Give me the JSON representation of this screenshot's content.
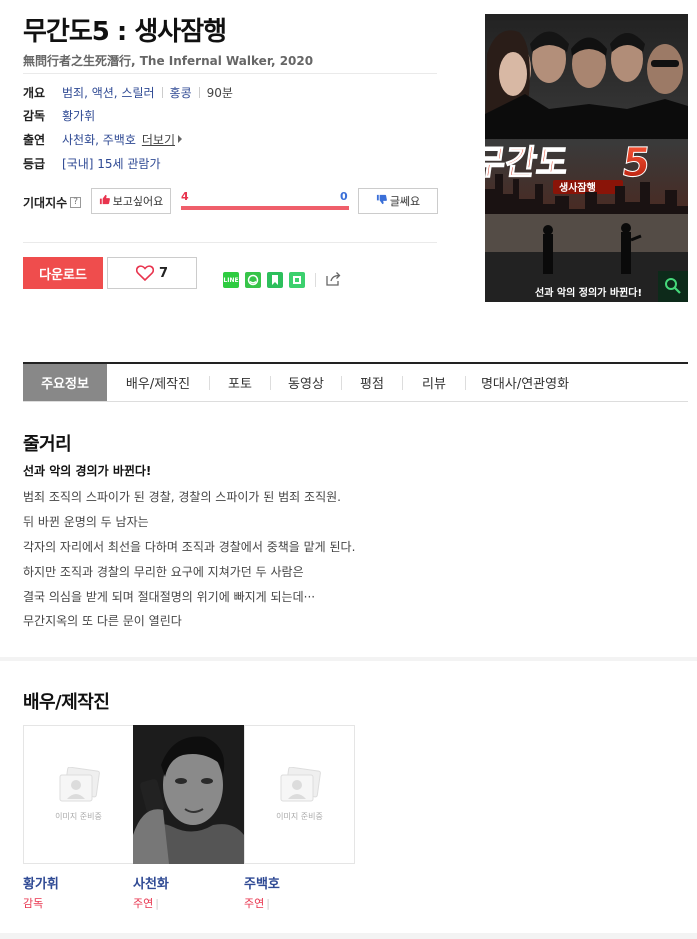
{
  "movie": {
    "title": "무간도5 : 생사잠행",
    "subtitle": "無問行者之生死潛行, The Infernal Walker, 2020"
  },
  "info": {
    "overview_label": "개요",
    "genres": "범죄, 액션, 스릴러",
    "country": "홍콩",
    "runtime": "90분",
    "director_label": "감독",
    "director": "황가휘",
    "cast_label": "출연",
    "cast": "사천화, 주백호",
    "more_label": "더보기",
    "rating_label": "등급",
    "rating": "[국내] 15세 관람가"
  },
  "expect": {
    "label": "기대지수",
    "help_glyph": "?",
    "want_label": "보고싶어요",
    "nah_label": "글쎄요",
    "want_count": "4",
    "nah_count": "0",
    "want_ratio": 1.0
  },
  "actions": {
    "download_label": "다운로드",
    "like_count": "7"
  },
  "share": {
    "icons": [
      "line-icon",
      "band-icon",
      "kakaostory-icon",
      "blog-icon",
      "share-arrow-icon"
    ],
    "line_text": "LINE"
  },
  "tabs": [
    {
      "label": "주요정보",
      "active": true
    },
    {
      "label": "배우/제작진",
      "active": false
    },
    {
      "label": "포토",
      "active": false
    },
    {
      "label": "동영상",
      "active": false
    },
    {
      "label": "평점",
      "active": false
    },
    {
      "label": "리뷰",
      "active": false
    },
    {
      "label": "명대사/연관영화",
      "active": false
    }
  ],
  "synopsis": {
    "heading": "줄거리",
    "tagline": "선과 악의 경의가 바뀐다!",
    "lines": [
      "범죄 조직의 스파이가 된 경찰, 경찰의 스파이가 된 범죄 조직원.",
      " 뒤 바뀐 운명의 두 남자는",
      " 각자의 자리에서 최선을 다하며 조직과 경찰에서 중책을 맡게 된다.",
      " 하지만 조직과 경찰의 무리한 요구에 지쳐가던 두 사람은",
      " 결국 의심을 받게 되며 절대절명의 위기에 빠지게 되는데···",
      " 무간지옥의 또 다른 문이 열린다"
    ]
  },
  "cast_section": {
    "heading": "배우/제작진",
    "noimage_caption": "이미지 준비중",
    "people": [
      {
        "name": "황가휘",
        "role": "감독",
        "has_photo": false
      },
      {
        "name": "사천화",
        "role": "주연",
        "has_photo": true
      },
      {
        "name": "주백호",
        "role": "주연",
        "has_photo": false
      }
    ]
  },
  "colors": {
    "accent_red": "#ef4d4d",
    "link_blue": "#2f4a94",
    "want_red": "#e8344e",
    "nah_blue": "#3a6fd8"
  }
}
